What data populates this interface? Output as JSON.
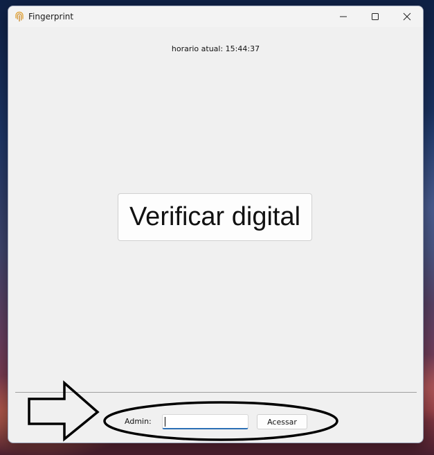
{
  "window": {
    "title": "Fingerprint",
    "icon": "fingerprint-icon",
    "controls": [
      "minimize-icon",
      "maximize-icon",
      "close-icon"
    ]
  },
  "main": {
    "clock_text": "horario atual: 15:44:37",
    "verify_button_label": "Verificar digital"
  },
  "footer": {
    "admin_label": "Admin:",
    "admin_input_value": "",
    "access_button_label": "Acessar"
  },
  "annotations": {
    "arrow": "right-arrow-annotation",
    "ellipse": "highlight-ellipse-annotation"
  },
  "colors": {
    "window_bg": "#f0f0f0",
    "input_focus_underline": "#2a6fb5",
    "annotation_stroke": "#000000"
  }
}
